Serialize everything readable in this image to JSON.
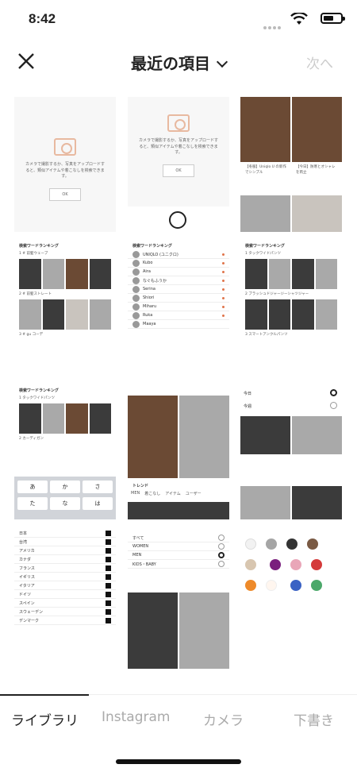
{
  "status": {
    "time": "8:42"
  },
  "nav": {
    "title": "最近の項目",
    "next": "次へ"
  },
  "empty_tile": {
    "message": "カメラで撮影するか、写真をアップロードすると、類似アイテムや着こなしを検索できます。",
    "ok": "OK"
  },
  "ranking": {
    "heading": "検索ワードランキング",
    "items": [
      "1 # 前髪ウェーブ",
      "2 # 前髪ストレート",
      "3 # gu コーデ",
      "1 タックワイドパンツ",
      "2 カーディガン"
    ]
  },
  "ranking_users": [
    "UNIQLO (ユニクロ)",
    "Kubo",
    "Aira",
    "なぐもふうか",
    "Serina",
    "Shiori",
    "Miharu",
    "Ruka",
    "Maaya"
  ],
  "ranking_right": [
    "1 タックワイドパンツ",
    "2 ブラッシュドジャージーシャツジャー",
    "3 スマートアンクルパンツ"
  ],
  "trend": {
    "title": "トレンド",
    "tabs": [
      "MEN",
      "着こなし",
      "アイテム",
      "ユーザー"
    ]
  },
  "filter_options": [
    "すべて",
    "WOMEN",
    "MEN",
    "KIDS・BABY"
  ],
  "date_options": [
    "今日",
    "今週"
  ],
  "countries": [
    "日本",
    "台湾",
    "アメリカ",
    "カナダ",
    "フランス",
    "イギリス",
    "イタリア",
    "ドイツ",
    "スペイン",
    "スウェーデン",
    "デンマーク"
  ],
  "keyboard_row": [
    "あ",
    "か",
    "さ",
    "た",
    "な",
    "は"
  ],
  "colors": {
    "labels": [
      "ホワイト",
      "グレー",
      "ブラック",
      "ブラウン",
      "ベージュ",
      "パープル",
      "ピンク",
      "レッド",
      "オレンジ",
      "ブルー",
      "グリーン"
    ],
    "values": [
      "#f2f2f2",
      "#a5a5a5",
      "#333333",
      "#7a5a44",
      "#d8c6b0",
      "#7a1f7d",
      "#e9a6b8",
      "#d43a3a",
      "#ee8a2a",
      "#fff6ef",
      "#3a62c4",
      "#4ba86a"
    ]
  },
  "post_captions": [
    "【冬服】Uniqlo U の新作でシンプル",
    "【今日】防寒とオシャレを両立"
  ],
  "tabs": [
    "ライブラリ",
    "Instagram",
    "カメラ",
    "下書き"
  ]
}
